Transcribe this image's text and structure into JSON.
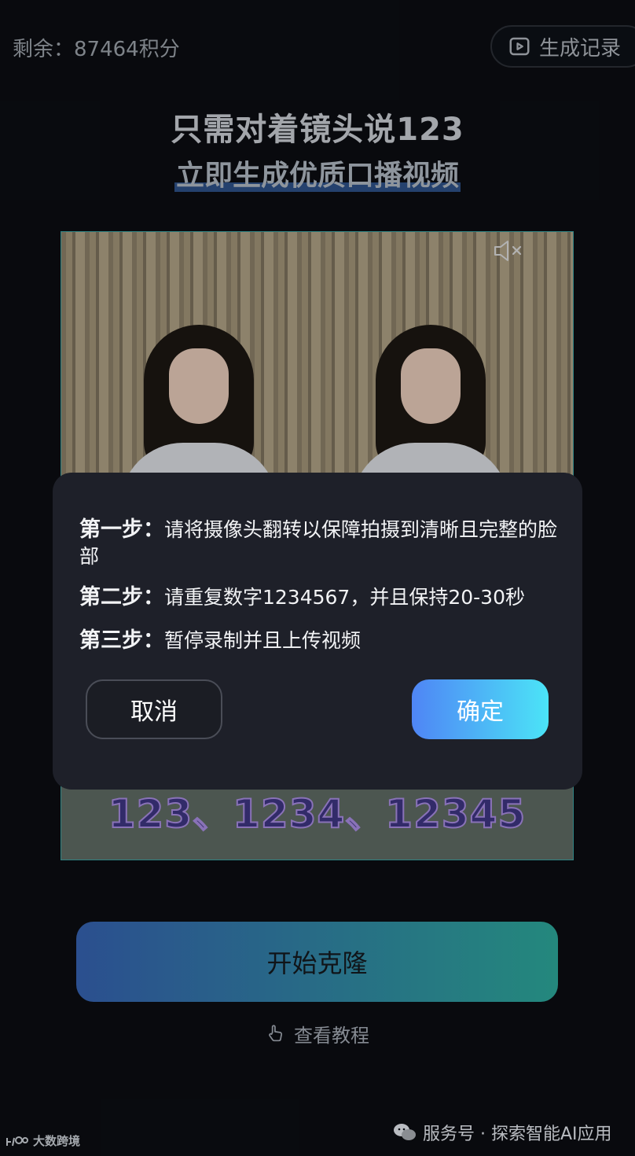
{
  "header": {
    "credits_text": "剩余：87464积分",
    "history_label": "生成记录"
  },
  "headline": {
    "line1": "只需对着镜头说123",
    "line2": "立即生成优质口播视频"
  },
  "video": {
    "overlay_text": "123、1234、12345"
  },
  "dialog": {
    "step1_title": "第一步：",
    "step1_text": "请将摄像头翻转以保障拍摄到清晰且完整的脸部",
    "step2_title": "第二步：",
    "step2_text": "请重复数字1234567，并且保持20-30秒",
    "step3_title": "第三步：",
    "step3_text": "暂停录制并且上传视频",
    "cancel_label": "取消",
    "confirm_label": "确定"
  },
  "actions": {
    "start_clone_label": "开始克隆",
    "tutorial_label": "查看教程"
  },
  "watermarks": {
    "left": "大数跨境",
    "right": "服务号 · 探索智能AI应用"
  },
  "colors": {
    "background": "#0b0d12",
    "confirm_gradient_start": "#4f85f5",
    "confirm_gradient_end": "#4be4f7",
    "clone_gradient_start": "#2b4f8f",
    "clone_gradient_end": "#24887d"
  }
}
